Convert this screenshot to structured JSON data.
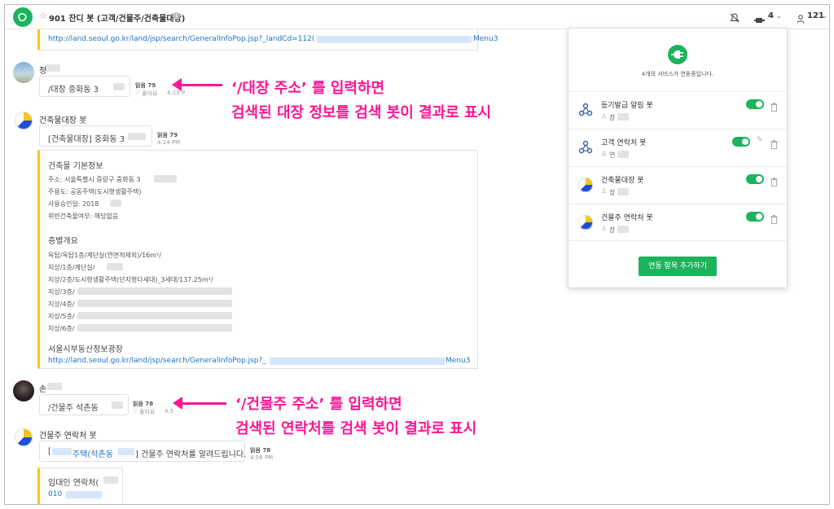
{
  "header": {
    "title": "901 잔디 봇 (고객/건물주/건축물대장)",
    "info_icon": "i",
    "members_count": "4",
    "users_count": "121"
  },
  "messages": {
    "top_link": "http://land.seoul.go.kr/land/jsp/search/GeneralInfoPop.jsp?_landCd=112(",
    "top_link_tail": "Menu3",
    "msg1": {
      "sender": "정",
      "text": "/대장 중화동 3",
      "read": "읽음 79",
      "like": "좋아요",
      "time": "4:23 P"
    },
    "bot1": {
      "sender": "건축물대장 봇",
      "query_text": "[건축물대장] 중화동 3",
      "read": "읽음 79",
      "time": "4:24 PM",
      "section1_title": "건축물 기본정보",
      "section1_lines": [
        "주소: 서울특별시 중랑구 중화동 3",
        "주용도: 공동주택(도시형생활주택)",
        "사용승인일: 2018",
        "위반건축물여부: 해당없음"
      ],
      "section2_title": "층별개요",
      "section2_lines": [
        "옥탑/옥탑1층/계단실(연면적제외)/16m²/",
        "지상/1층/계단실/",
        "지상/2층/도시형생활주택(단지형다세대)_3세대/137.25m²/",
        "지상/3층/",
        "지상/4층/",
        "지상/5층/",
        "지상/6층/"
      ],
      "section3_title": "서울시부동산정보광장",
      "link": "http://land.seoul.go.kr/land/jsp/search/GeneralInfoPop.jsp?_",
      "link_tail": "Menu3"
    },
    "msg2": {
      "sender": "손",
      "text": "/건물주 석촌동",
      "read": "읽음 78",
      "like": "좋아요",
      "time": "4:5"
    },
    "bot2": {
      "sender": "건물주 연락처 봇",
      "text_prefix": "[",
      "text_link": "주택(석촌동",
      "text_suffix": "] 건물주 연락처를 알려드립니다.",
      "read": "읽음 78",
      "time": "4:56 PM",
      "card_title": "임대인 연락처(",
      "card_phone": "010"
    }
  },
  "annotations": {
    "a1_line1": "‘/대장 주소’ 를 입력하면",
    "a1_line2": "검색된 대장 정보를 검색 봇이 결과로 표시",
    "a2_line1": "‘/건물주 주소’ 를 입력하면",
    "a2_line2": "검색된 연락처를 검색 봇이 결과로 표시",
    "color": "#ff1493"
  },
  "panel": {
    "message": "4개의 서비스가 연동중입니다.",
    "items": [
      {
        "name": "등기발급 알림 봇",
        "user": "장",
        "icon": "webhook-icon"
      },
      {
        "name": "고객 연락처 봇",
        "user": "연",
        "icon": "webhook-icon"
      },
      {
        "name": "건축물대장 봇",
        "user": "장",
        "icon": "bot-avatar-icon"
      },
      {
        "name": "건물주 연락처 봇",
        "user": "장",
        "icon": "bot-avatar-icon"
      }
    ],
    "add_button": "연동 항목 추가하기",
    "accent": "#1bb35c"
  }
}
